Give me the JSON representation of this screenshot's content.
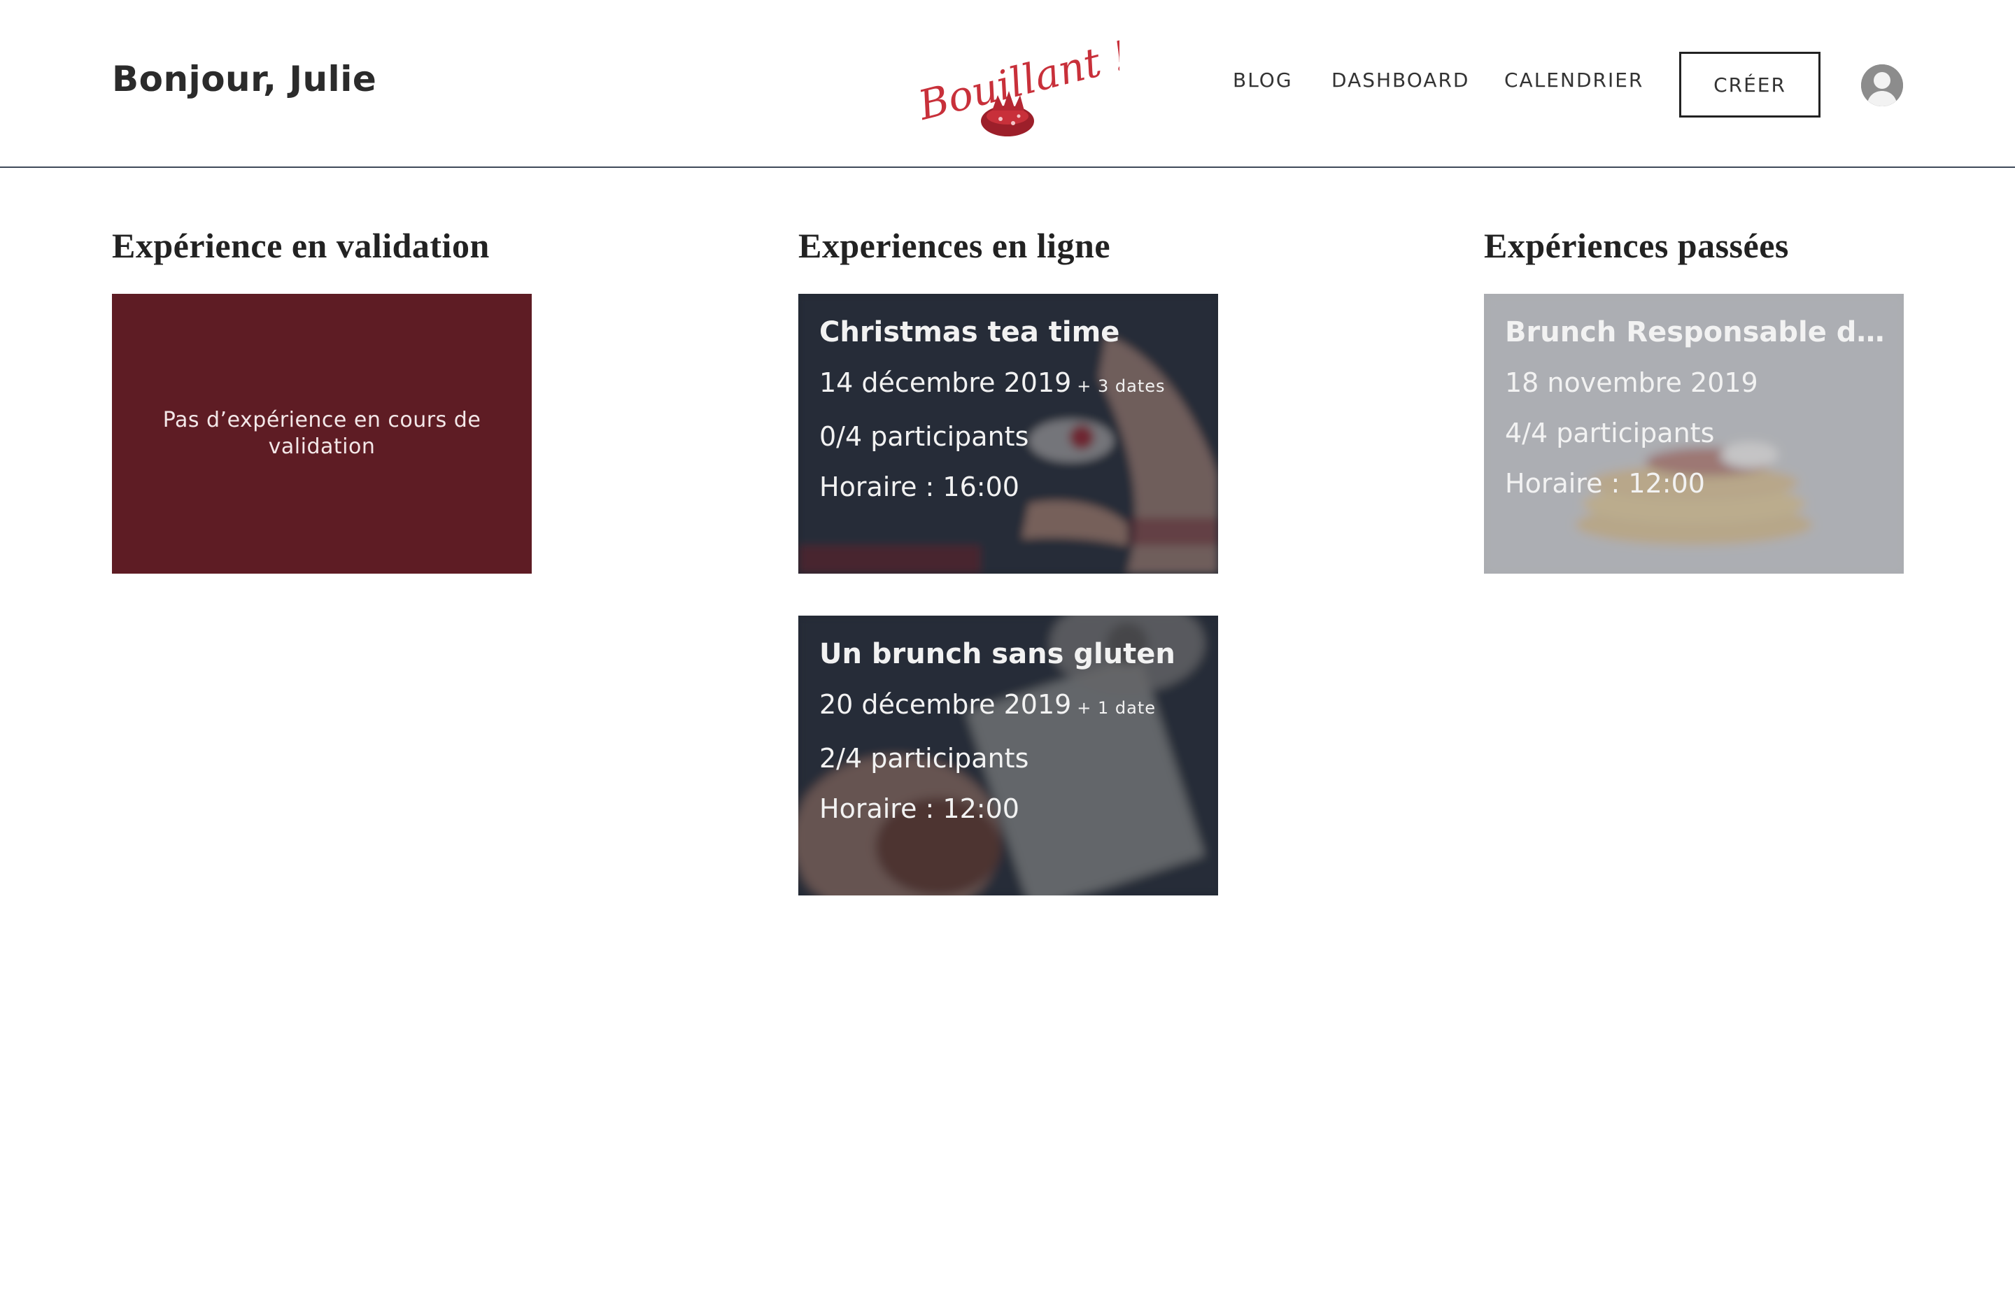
{
  "header": {
    "greeting": "Bonjour, Julie",
    "logo_text": "Bouillant !",
    "nav": {
      "blog": "BLOG",
      "dashboard": "DASHBOARD",
      "calendar": "CALENDRIER"
    },
    "create_label": "CRÉER",
    "avatar_icon": "user-avatar-icon"
  },
  "columns": {
    "validation": {
      "title": "Expérience en validation",
      "empty_message": "Pas d’expérience en cours de validation"
    },
    "online": {
      "title": "Experiences en ligne",
      "cards": [
        {
          "title": "Christmas tea time",
          "date": "14 décembre 2019",
          "more_dates": "+ 3 dates",
          "participants": "0/4 participants",
          "schedule": "Horaire : 16:00"
        },
        {
          "title": "Un brunch sans gluten",
          "date": "20 décembre 2019",
          "more_dates": "+ 1 date",
          "participants": "2/4 participants",
          "schedule": "Horaire : 12:00"
        }
      ]
    },
    "past": {
      "title": "Expériences passées",
      "cards": [
        {
          "title": "Brunch Responsable de…",
          "date": "18 novembre 2019",
          "participants": "4/4 participants",
          "schedule": "Horaire : 12:00"
        }
      ]
    }
  },
  "colors": {
    "accent": "#5e1c24",
    "header_border": "#3f4a5a",
    "logo_red": "#c8303a"
  }
}
